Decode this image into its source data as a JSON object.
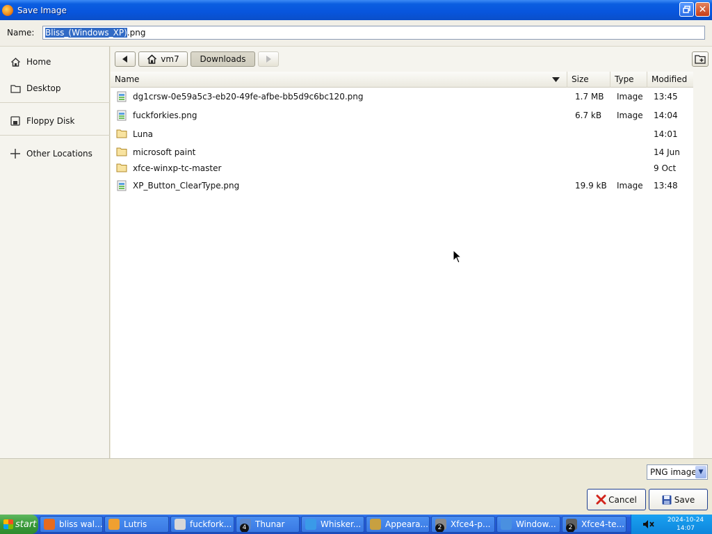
{
  "window": {
    "title": "Save Image"
  },
  "name_field": {
    "label": "Name:",
    "value_selected": "Bliss_(Windows_XP)",
    "value_rest": ".png"
  },
  "sidebar": {
    "items": [
      {
        "label": "Home",
        "icon": "home-icon"
      },
      {
        "label": "Desktop",
        "icon": "folder-icon"
      },
      {
        "label": "Floppy Disk",
        "icon": "floppy-icon"
      },
      {
        "label": "Other Locations",
        "icon": "plus-icon"
      }
    ]
  },
  "pathbar": {
    "home": "vm7",
    "current": "Downloads"
  },
  "columns": {
    "name": "Name",
    "size": "Size",
    "type": "Type",
    "modified": "Modified"
  },
  "files": [
    {
      "name": "dg1crsw-0e59a5c3-eb20-49fe-afbe-bb5d9c6bc120.png",
      "size": "1.7 MB",
      "type": "Image",
      "modified": "13:45",
      "icon": "image-icon"
    },
    {
      "name": "fuckforkies.png",
      "size": "6.7 kB",
      "type": "Image",
      "modified": "14:04",
      "icon": "image-icon"
    },
    {
      "name": "Luna",
      "size": "",
      "type": "",
      "modified": "14:01",
      "icon": "folder-icon"
    },
    {
      "name": "microsoft paint",
      "size": "",
      "type": "",
      "modified": "14 Jun",
      "icon": "folder-icon"
    },
    {
      "name": "xfce-winxp-tc-master",
      "size": "",
      "type": "",
      "modified": "9 Oct",
      "icon": "folder-icon"
    },
    {
      "name": "XP_Button_ClearType.png",
      "size": "19.9 kB",
      "type": "Image",
      "modified": "13:48",
      "icon": "image-icon"
    }
  ],
  "filetype": {
    "selected": "PNG image"
  },
  "buttons": {
    "cancel": "Cancel",
    "save": "Save"
  },
  "taskbar": {
    "start": "start",
    "tasks": [
      {
        "label": "bliss wal...",
        "badge": ""
      },
      {
        "label": "Lutris",
        "badge": ""
      },
      {
        "label": "fuckfork...",
        "badge": ""
      },
      {
        "label": "Thunar",
        "badge": "4"
      },
      {
        "label": "Whisker...",
        "badge": ""
      },
      {
        "label": "Appeara...",
        "badge": ""
      },
      {
        "label": "Xfce4-p...",
        "badge": "2"
      },
      {
        "label": "Window...",
        "badge": ""
      },
      {
        "label": "Xfce4-te...",
        "badge": "2"
      }
    ],
    "clock": {
      "date": "2024-10-24",
      "time": "14:07"
    }
  },
  "colors": {
    "titlebar": "#0855dd",
    "selection": "#316ac5",
    "taskbar": "#245edb",
    "start": "#3a9a3a"
  }
}
